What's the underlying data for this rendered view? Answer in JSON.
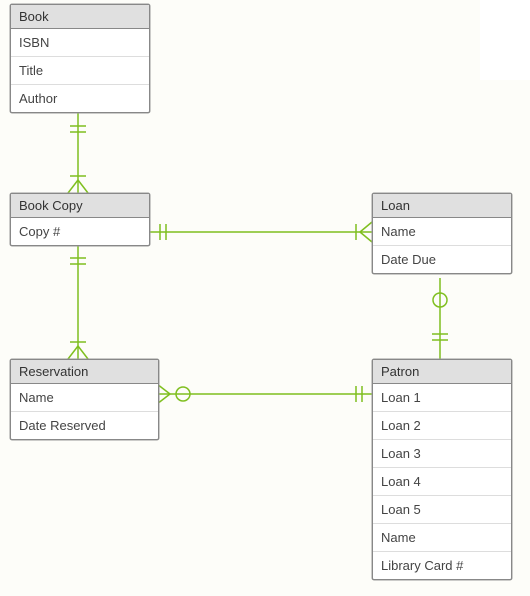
{
  "entities": {
    "book": {
      "title": "Book",
      "attrs": [
        "ISBN",
        "Title",
        "Author"
      ]
    },
    "book_copy": {
      "title": "Book Copy",
      "attrs": [
        "Copy #"
      ]
    },
    "loan": {
      "title": "Loan",
      "attrs": [
        "Name",
        "Date Due"
      ]
    },
    "reservation": {
      "title": "Reservation",
      "attrs": [
        "Name",
        "Date Reserved"
      ]
    },
    "patron": {
      "title": "Patron",
      "attrs": [
        "Loan 1",
        "Loan 2",
        "Loan 3",
        "Loan 4",
        "Loan 5",
        "Name",
        "Library Card #"
      ]
    }
  },
  "chart_data": {
    "type": "diagram",
    "diagram_type": "entity-relationship",
    "entities": [
      "Book",
      "Book Copy",
      "Loan",
      "Reservation",
      "Patron"
    ],
    "relationships": [
      {
        "from": "Book",
        "to": "Book Copy",
        "from_card": "one-and-only-one",
        "to_card": "one-or-many"
      },
      {
        "from": "Book Copy",
        "to": "Reservation",
        "from_card": "one-and-only-one",
        "to_card": "one-or-many"
      },
      {
        "from": "Book Copy",
        "to": "Loan",
        "from_card": "one-and-only-one",
        "to_card": "one-or-many"
      },
      {
        "from": "Reservation",
        "to": "Patron",
        "from_card": "zero-or-one",
        "to_card": "one-and-only-one"
      },
      {
        "from": "Loan",
        "to": "Patron",
        "from_card": "zero-or-one",
        "to_card": "one-and-only-one"
      }
    ]
  }
}
